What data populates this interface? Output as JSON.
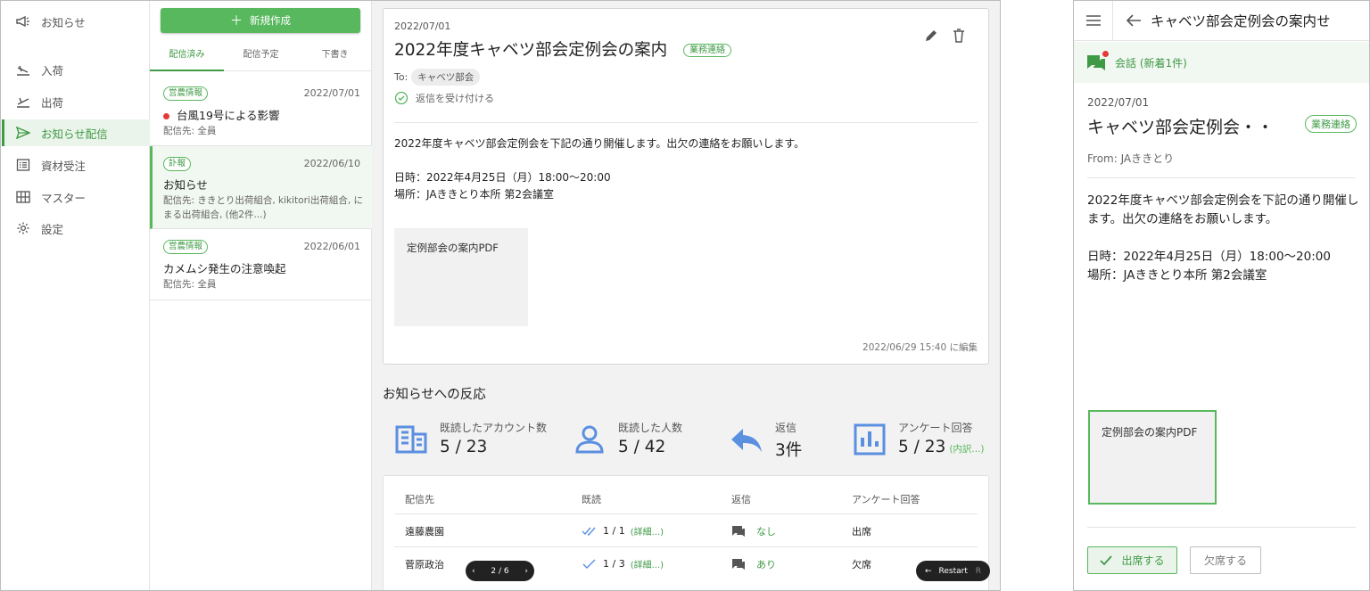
{
  "nav": {
    "items": [
      {
        "label": "お知らせ",
        "icon": "megaphone-icon"
      },
      {
        "label": "入荷",
        "icon": "flight-land-icon"
      },
      {
        "label": "出荷",
        "icon": "flight-takeoff-icon"
      },
      {
        "label": "お知らせ配信",
        "icon": "send-icon",
        "active": true
      },
      {
        "label": "資材受注",
        "icon": "list-alt-icon"
      },
      {
        "label": "マスター",
        "icon": "grid-icon"
      },
      {
        "label": "設定",
        "icon": "gear-icon"
      }
    ]
  },
  "list": {
    "new_button": "新規作成",
    "tabs": [
      "配信済み",
      "配信予定",
      "下書き"
    ],
    "rows": [
      {
        "tag": "営農情報",
        "date": "2022/07/01",
        "title": "台風19号による影響",
        "sub": "配信先: 全員",
        "unread": true
      },
      {
        "tag": "訃報",
        "date": "2022/06/10",
        "title": "お知らせ",
        "sub": "配信先: ききとり出荷組合, kikitori出荷組合, にまる出荷組合, (他2件...)"
      },
      {
        "tag": "営農情報",
        "date": "2022/06/01",
        "title": "カメムシ発生の注意喚起",
        "sub": "配信先: 全員"
      }
    ]
  },
  "detail": {
    "date": "2022/07/01",
    "title": "2022年度キャベツ部会定例会の案内",
    "category": "業務連絡",
    "to_label": "To:",
    "to_chip": "キャベツ部会",
    "reply_text": "返信を受け付ける",
    "body": "2022年度キャベツ部会定例会を下記の通り開催します。出欠の連絡をお願いします。\n\n日時：2022年4月25日（月）18:00〜20:00\n場所：JAききとり本所 第2会議室",
    "attachment": "定例部会の案内PDF",
    "edited": "2022/06/29 15:40 に編集"
  },
  "reactions": {
    "title": "お知らせへの反応",
    "stats": [
      {
        "label": "既読したアカウント数",
        "value": "5 / 23",
        "icon": "building-icon"
      },
      {
        "label": "既読した人数",
        "value": "5 / 42",
        "icon": "person-icon"
      },
      {
        "label": "返信",
        "value": "3件",
        "icon": "reply-icon"
      },
      {
        "label": "アンケート回答",
        "value": "5 / 23",
        "more": "(内訳...)",
        "icon": "bar-chart-icon"
      }
    ]
  },
  "table": {
    "headers": [
      "配信先",
      "既読",
      "返信",
      "アンケート回答"
    ],
    "rows": [
      {
        "name": "遠藤農園",
        "read": "1 / 1",
        "detail": "(詳細...)",
        "reply": "なし",
        "survey": "出席"
      },
      {
        "name": "菅原政治",
        "read": "1 / 3",
        "detail": "(詳細...)",
        "reply": "あり",
        "survey": "欠席"
      }
    ]
  },
  "pager": {
    "text": "2 / 6"
  },
  "restart": {
    "label": "Restart",
    "key": "R"
  },
  "mobile": {
    "title": "キャベツ部会定例会の案内せ",
    "conversation": "会話 (新着1件)",
    "date": "2022/07/01",
    "headline": "キャベツ部会定例会・・",
    "category": "業務連絡",
    "from": "From: JAききとり",
    "body": "2022年度キャベツ部会定例会を下記の通り開催します。出欠の連絡をお願いします。\n\n日時：2022年4月25日（月）18:00〜20:00\n場所：JAききとり本所 第2会議室",
    "attachment": "定例部会の案内PDF",
    "attend": "出席する",
    "absent": "欠席する"
  },
  "colors": {
    "accent": "#58b85d",
    "accent_dark": "#3f9a46",
    "stat_icon": "#5b8fe0",
    "alert": "#e53935"
  }
}
